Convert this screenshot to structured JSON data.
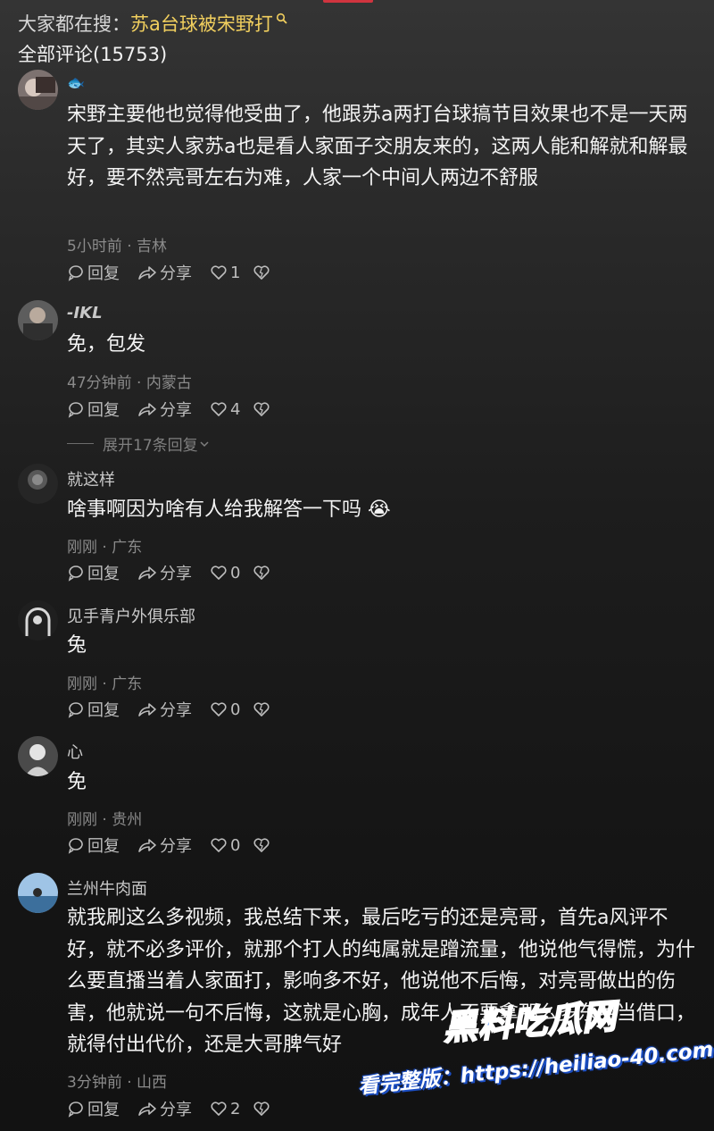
{
  "search": {
    "prefix": "大家都在搜：",
    "keyword": "苏a台球被宋野打"
  },
  "comments_header": {
    "label": "全部评论(15753)"
  },
  "comments": [
    {
      "username": "🐟",
      "content": "宋野主要他也觉得他受曲了，他跟苏a两打台球搞节目效果也不是一天两天了，其实人家苏a也是看人家面子交朋友来的，这两人能和解就和解最好，要不然亮哥左右为难，人家一个中间人两边不舒服",
      "meta": "5小时前 · 吉林",
      "reply_label": "回复",
      "share_label": "分享",
      "likes": "1"
    },
    {
      "username": "-IKL",
      "content": "免，包发",
      "meta": "47分钟前 · 内蒙古",
      "reply_label": "回复",
      "share_label": "分享",
      "likes": "4",
      "expand_label": "展开17条回复"
    },
    {
      "username": "就这样",
      "content": "啥事啊因为啥有人给我解答一下吗 😭",
      "meta": "刚刚 · 广东",
      "reply_label": "回复",
      "share_label": "分享",
      "likes": "0"
    },
    {
      "username": "见手青户外俱乐部",
      "content": "兔",
      "meta": "刚刚 · 广东",
      "reply_label": "回复",
      "share_label": "分享",
      "likes": "0"
    },
    {
      "username": "心",
      "content": "免",
      "meta": "刚刚 · 贵州",
      "reply_label": "回复",
      "share_label": "分享",
      "likes": "0"
    },
    {
      "username": "兰州牛肉面",
      "content": "就我刷这么多视频，我总结下来，最后吃亏的还是亮哥，首先a风评不好，就不必多评价，就那个打人的纯属就是蹭流量，他说他气得慌，为什么要直播当着人家面打，影响多不好，他说他不后悔，对亮哥做出的伤害，他就说一句不后悔，这就是心胸，成年人不要拿那么多东西当借口，就得付出代价，还是大哥脾气好",
      "meta": "3分钟前 · 山西",
      "reply_label": "回复",
      "share_label": "分享",
      "likes": "2"
    }
  ],
  "watermark": {
    "logo": "黑料吃瓜网",
    "url": "看完整版：https://heiliao-40.com"
  },
  "colors": {
    "keyword": "#f1cf5e",
    "top_accent": "#d0343f",
    "watermark_blue": "#3d7ff0"
  }
}
